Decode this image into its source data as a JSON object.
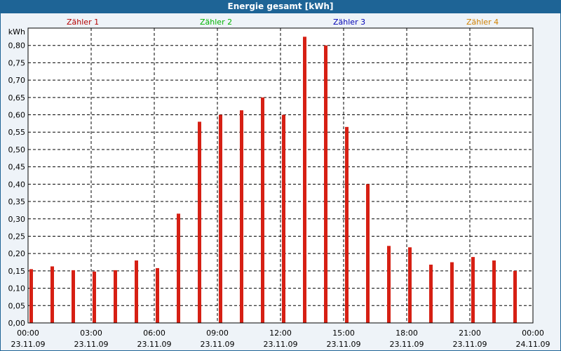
{
  "window": {
    "title": "Energie gesamt [kWh]"
  },
  "legend": [
    {
      "label": "Zähler 1",
      "color": "#b40000"
    },
    {
      "label": "Zähler 2",
      "color": "#00b400"
    },
    {
      "label": "Zähler 3",
      "color": "#0000b4"
    },
    {
      "label": "Zähler 4",
      "color": "#d08000"
    }
  ],
  "chart_data": {
    "type": "bar",
    "title": "Energie gesamt [kWh]",
    "ylabel": "kWh",
    "xlabel": "",
    "ylim": [
      0,
      0.85
    ],
    "xlim_hours": [
      0,
      24
    ],
    "grid": true,
    "bar_color": "#d62014",
    "y_ticks": [
      "0,00",
      "0,05",
      "0,10",
      "0,15",
      "0,20",
      "0,25",
      "0,30",
      "0,35",
      "0,40",
      "0,45",
      "0,50",
      "0,55",
      "0,60",
      "0,65",
      "0,70",
      "0,75",
      "0,80"
    ],
    "x_ticks": [
      {
        "time": "00:00",
        "date": "23.11.09"
      },
      {
        "time": "03:00",
        "date": "23.11.09"
      },
      {
        "time": "06:00",
        "date": "23.11.09"
      },
      {
        "time": "09:00",
        "date": "23.11.09"
      },
      {
        "time": "12:00",
        "date": "23.11.09"
      },
      {
        "time": "15:00",
        "date": "23.11.09"
      },
      {
        "time": "18:00",
        "date": "23.11.09"
      },
      {
        "time": "21:00",
        "date": "23.11.09"
      },
      {
        "time": "00:00",
        "date": "24.11.09"
      }
    ],
    "series": [
      {
        "name": "Zähler 1",
        "hours": [
          0,
          1,
          2,
          3,
          4,
          5,
          6,
          7,
          8,
          9,
          10,
          11,
          12,
          13,
          14,
          15,
          16,
          17,
          18,
          19,
          20,
          21,
          22,
          23
        ],
        "values": [
          0.155,
          0.163,
          0.152,
          0.148,
          0.152,
          0.18,
          0.158,
          0.315,
          0.58,
          0.6,
          0.613,
          0.65,
          0.6,
          0.825,
          0.8,
          0.565,
          0.4,
          0.222,
          0.218,
          0.168,
          0.175,
          0.19,
          0.18,
          0.15
        ]
      }
    ]
  }
}
